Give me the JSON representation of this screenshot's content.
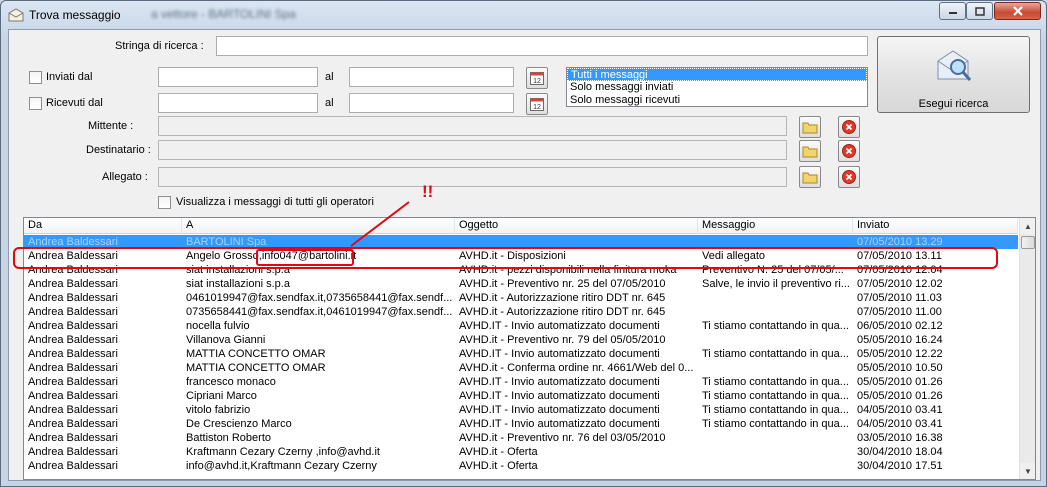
{
  "window": {
    "title": "Trova messaggio",
    "blurred_title": "a vettore - BARTOLINI Spa"
  },
  "filters": {
    "search_label": "Stringa di ricerca :",
    "search_value": "",
    "sent_from_label": "Inviati dal",
    "received_from_label": "Ricevuti dal",
    "al_label": "al",
    "sender_label": "Mittente :",
    "recipient_label": "Destinatario :",
    "attachment_label": "Allegato :",
    "show_all_operators_label": "Visualizza i messaggi di tutti gli operatori"
  },
  "message_types": {
    "options": [
      "Tutti i messaggi",
      "Solo messaggi inviati",
      "Solo messaggi ricevuti"
    ],
    "selected": "Tutti i messaggi"
  },
  "search_button": {
    "label": "Esegui ricerca"
  },
  "grid": {
    "columns": [
      "Da",
      "A",
      "Oggetto",
      "Messaggio",
      "Inviato"
    ],
    "rows": [
      [
        "Andrea Baldessari",
        "BARTOLINI Spa",
        "",
        "",
        "07/05/2010 13.29"
      ],
      [
        "Andrea Baldessari",
        "Angelo Grosso,info047@bartolini.it",
        "AVHD.it - Disposizioni",
        "Vedi allegato",
        "07/05/2010 13.11"
      ],
      [
        "Andrea Baldessari",
        "siat installazioni s.p.a",
        "AVHD.it - pezzi disponibili nella finitura moka",
        "Preventivo N. 25 del 07/05/...",
        "07/05/2010 12.04"
      ],
      [
        "Andrea Baldessari",
        "siat installazioni s.p.a",
        "AVHD.it - Preventivo nr. 25 del 07/05/2010",
        "Salve, le invio il preventivo ri...",
        "07/05/2010 12.02"
      ],
      [
        "Andrea Baldessari",
        "0461019947@fax.sendfax.it,0735658441@fax.sendf...",
        "AVHD.it - Autorizzazione ritiro DDT nr. 645",
        "",
        "07/05/2010 11.03"
      ],
      [
        "Andrea Baldessari",
        "0735658441@fax.sendfax.it,0461019947@fax.sendf...",
        "AVHD.it - Autorizzazione ritiro DDT nr. 645",
        "",
        "07/05/2010 11.00"
      ],
      [
        "Andrea Baldessari",
        "nocella fulvio",
        "AVHD.IT - Invio automatizzato documenti",
        "Ti stiamo contattando in qua...",
        "06/05/2010 02.12"
      ],
      [
        "Andrea Baldessari",
        "Villanova Gianni",
        "AVHD.it - Preventivo nr. 79 del 05/05/2010",
        "",
        "05/05/2010 16.24"
      ],
      [
        "Andrea Baldessari",
        "MATTIA CONCETTO OMAR",
        "AVHD.IT - Invio automatizzato documenti",
        "Ti stiamo contattando in qua...",
        "05/05/2010 12.22"
      ],
      [
        "Andrea Baldessari",
        "MATTIA CONCETTO OMAR",
        "AVHD.it - Conferma ordine nr. 4661/Web del 0...",
        "",
        "05/05/2010 10.50"
      ],
      [
        "Andrea Baldessari",
        "francesco monaco",
        "AVHD.IT - Invio automatizzato documenti",
        "Ti stiamo contattando in qua...",
        "05/05/2010 01.26"
      ],
      [
        "Andrea Baldessari",
        "Cipriani Marco",
        "AVHD.IT - Invio automatizzato documenti",
        "Ti stiamo contattando in qua...",
        "05/05/2010 01.26"
      ],
      [
        "Andrea Baldessari",
        "vitolo fabrizio",
        "AVHD.IT - Invio automatizzato documenti",
        "Ti stiamo contattando in qua...",
        "04/05/2010 03.41"
      ],
      [
        "Andrea Baldessari",
        "De Crescienzo Marco",
        "AVHD.IT - Invio automatizzato documenti",
        "Ti stiamo contattando in qua...",
        "04/05/2010 03.41"
      ],
      [
        "Andrea Baldessari",
        "Battiston Roberto",
        "AVHD.it - Preventivo nr. 76 del 03/05/2010",
        "",
        "03/05/2010 16.38"
      ],
      [
        "Andrea Baldessari",
        "Kraftmann Cezary Czerny ,info@avhd.it",
        "AVHD.it - Oferta",
        "",
        "30/04/2010 18.04"
      ],
      [
        "Andrea Baldessari",
        "info@avhd.it,Kraftmann Cezary Czerny",
        "AVHD.it - Oferta",
        "",
        "30/04/2010 17.51"
      ]
    ],
    "selected_row": 0
  },
  "annotation": {
    "text": "!!",
    "color": "#e30613"
  }
}
